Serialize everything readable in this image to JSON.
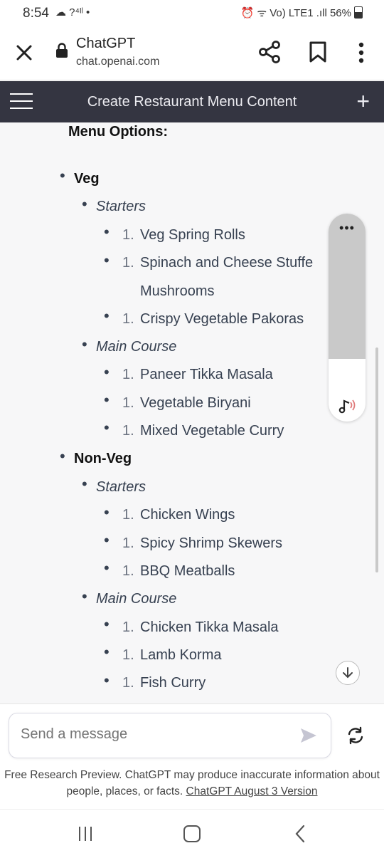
{
  "status_bar": {
    "time": "8:54",
    "left_icons_text": "☁ ?⁴ᴵˡ •",
    "right_text": "⏰ ᯤ Vo) LTE1 .ıll 56%",
    "battery_level": 0.56
  },
  "browser": {
    "site_title": "ChatGPT",
    "site_url": "chat.openai.com",
    "close_icon": "close-icon",
    "share_icon": "share-icon",
    "bookmark_icon": "bookmark-icon",
    "more_icon": "more-vertical-icon"
  },
  "app_header": {
    "title": "Create Restaurant Menu Content",
    "new_chat_symbol": "+"
  },
  "menu": {
    "heading": "Menu Options:",
    "veg": {
      "label": "Veg",
      "starters_label": "Starters",
      "starters": {
        "n1": "1.",
        "i1": "Veg Spring Rolls",
        "n2": "1.",
        "i2a": "Spinach and Cheese Stuffe",
        "i2b": "Mushrooms",
        "n3": "1.",
        "i3": "Crispy Vegetable Pakoras"
      },
      "main_label": "Main Course",
      "main": {
        "n1": "1.",
        "i1": "Paneer Tikka Masala",
        "n2": "1.",
        "i2": "Vegetable Biryani",
        "n3": "1.",
        "i3": "Mixed Vegetable Curry"
      }
    },
    "nonveg": {
      "label": "Non-Veg",
      "starters_label": "Starters",
      "starters": {
        "n1": "1.",
        "i1": "Chicken Wings",
        "n2": "1.",
        "i2": "Spicy Shrimp Skewers",
        "n3": "1.",
        "i3": "BBQ Meatballs"
      },
      "main_label": "Main Course",
      "main": {
        "n1": "1.",
        "i1": "Chicken Tikka Masala",
        "n2": "1.",
        "i2": "Lamb Korma",
        "n3": "1.",
        "i3": "Fish Curry"
      }
    }
  },
  "floating_panel": {
    "dots": "•••",
    "audio_icon": "audio-read-icon"
  },
  "composer": {
    "placeholder": "Send a message",
    "send_icon": "send-icon",
    "regenerate_icon": "regenerate-icon"
  },
  "disclaimer": {
    "text": "Free Research Preview. ChatGPT may produce inaccurate information about people, places, or facts. ",
    "link": "ChatGPT August 3 Version"
  },
  "nav": {
    "recent_icon": "recent-apps-icon",
    "home_icon": "home-icon",
    "back_icon": "back-icon"
  },
  "colors": {
    "header_bg": "#343541",
    "content_bg": "#f7f7f8",
    "text": "#374151"
  }
}
